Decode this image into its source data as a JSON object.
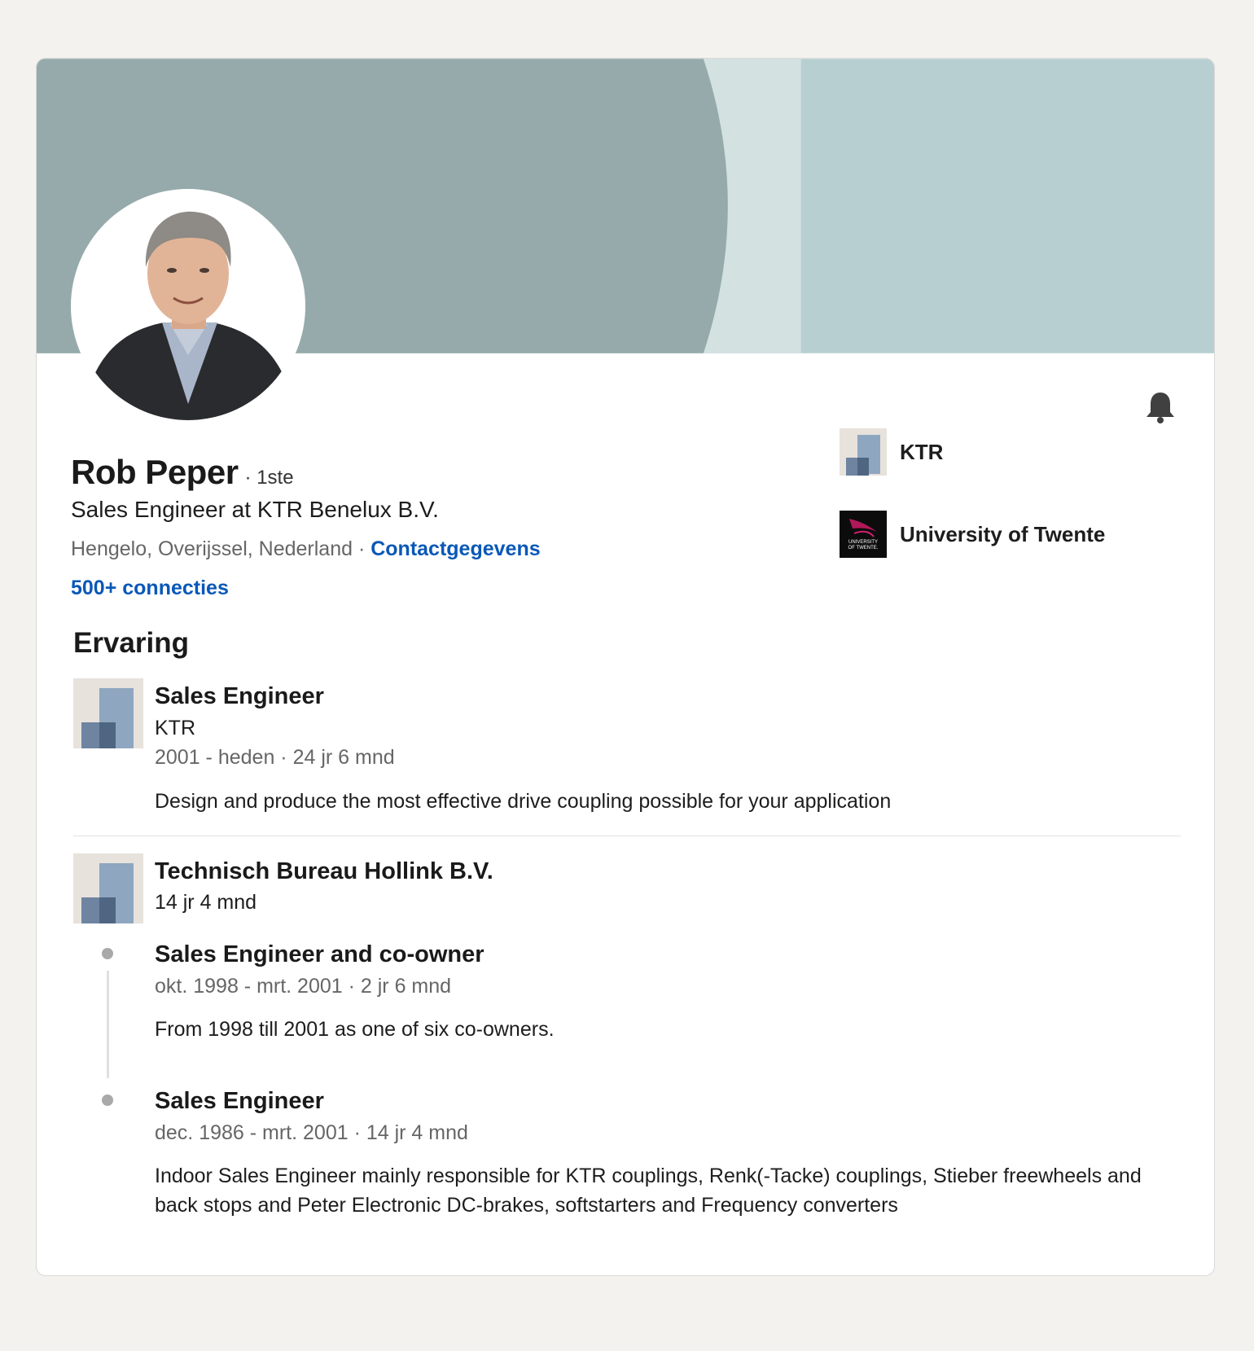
{
  "profile": {
    "name": "Rob Peper",
    "degree": "· 1ste",
    "headline": "Sales Engineer at KTR Benelux B.V.",
    "location": "Hengelo, Overijssel, Nederland",
    "separator": " · ",
    "contact_link": "Contactgegevens",
    "connections": "500+ connecties",
    "colors": {
      "banner_dark": "#96aaab",
      "banner_mid": "#d3e1e1",
      "banner_light": "#b8cfd1",
      "link": "#0a58b7"
    }
  },
  "affiliations": [
    {
      "label": "KTR",
      "icon": "company-logo-icon"
    },
    {
      "label": "University of Twente",
      "icon": "university-logo-icon",
      "logo_text_1": "UNIVERSITY",
      "logo_text_2": "OF TWENTE."
    }
  ],
  "experience": {
    "title": "Ervaring",
    "items": [
      {
        "role": "Sales Engineer",
        "company": "KTR",
        "dates": "2001 - heden · 24 jr 6 mnd",
        "description": "Design and produce the most effective drive coupling possible for your application"
      }
    ],
    "group": {
      "company": "Technisch Bureau Hollink B.V.",
      "duration": "14 jr 4 mnd",
      "positions": [
        {
          "role": "Sales Engineer and co-owner",
          "dates": "okt. 1998 - mrt. 2001 · 2 jr 6 mnd",
          "description": "From 1998 till 2001 as one of six co-owners."
        },
        {
          "role": "Sales Engineer",
          "dates": "dec. 1986 - mrt. 2001 · 14 jr 4 mnd",
          "description": "Indoor Sales Engineer mainly responsible for KTR couplings, Renk(-Tacke) couplings, Stieber freewheels and back stops and Peter Electronic DC-brakes, softstarters and Frequency converters"
        }
      ]
    }
  }
}
